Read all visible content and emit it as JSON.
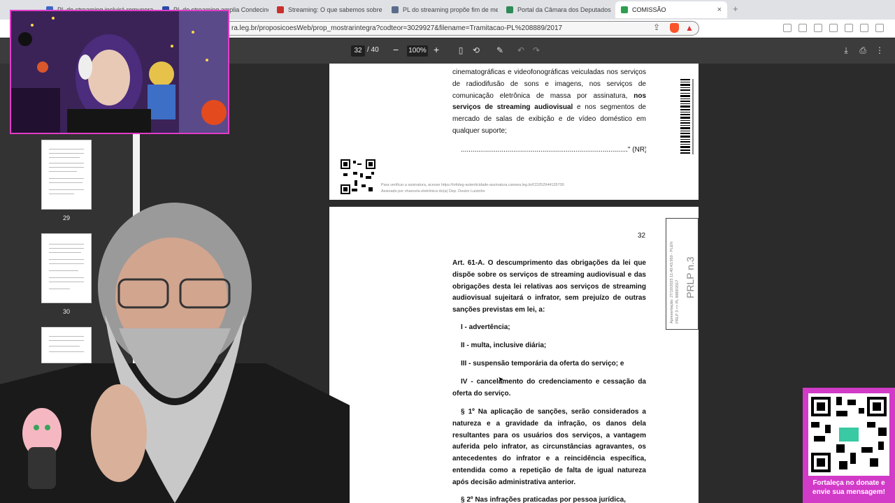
{
  "tabs": [
    {
      "label": "PL do streaming incluirá remunera",
      "color": "#3b67c7"
    },
    {
      "label": "PL do streaming amplia Condecine",
      "color": "#2a4aa8"
    },
    {
      "label": "Streaming: O que sabemos sobre",
      "color": "#c9302c"
    },
    {
      "label": "PL do streaming propõe fim de me",
      "color": "#5b6c8a"
    },
    {
      "label": "Portal da Câmara dos Deputados",
      "color": "#2e8b57"
    },
    {
      "label": "COMISSÃO",
      "color": "#2e9e4f"
    }
  ],
  "tab_close": "×",
  "new_tab": "+",
  "address": {
    "url": "ra.leg.br/proposicoesWeb/prop_mostrarintegra?codteor=3029927&filename=Tramitacao-PL%208889/2017"
  },
  "pdf_toolbar": {
    "page_current": "32",
    "page_total": "/ 40",
    "zoom_minus": "−",
    "zoom": "100%",
    "zoom_plus": "+"
  },
  "thumbnails": [
    {
      "num": "29"
    },
    {
      "num": "30"
    }
  ],
  "page_a": {
    "paragraph_html_parts": [
      "cinematográficas e videofonográficas veiculadas nos serviços de radiodifusão de sons e imagens, nos serviços de comunicação eletrônica de massa por assinatura,",
      "nos serviços de streaming audiovisual",
      "e nos segmentos de mercado de salas de exibição e de vídeo doméstico em qualquer suporte;"
    ],
    "nr_line": "......................................................................................\" (NR)",
    "verify_line1": "Para verificar a assinatura, acesse https://infoleg-autenticidade-assinatura.camara.leg.br/CD252944135700",
    "verify_line2": "Assinado por chancela eletrônica do(a) Dep. Doutor Luizinho"
  },
  "page_b": {
    "page_number": "32",
    "art": "Art. 61-A. O descumprimento das obrigações da lei que dispõe sobre os serviços de streaming audiovisual e das obrigações desta lei relativas aos serviços de streaming audiovisual sujeitará o infrator, sem prejuízo de outras sanções previstas em lei, a:",
    "item1": "I - advertência;",
    "item2": "II - multa, inclusive diária;",
    "item3": "III - suspensão temporária da oferta do serviço; e",
    "item4": "IV - cancelamento do credenciamento e cessação da oferta do serviço.",
    "par1": "§ 1º Na aplicação de sanções, serão considerados a natureza e a gravidade da infração, os danos dela resultantes para os usuários dos serviços, a vantagem auferida pelo infrator, as circunstâncias agravantes, os antecedentes do infrator e a reincidência específica, entendida como a repetição de falta de igual natureza após decisão administrativa anterior.",
    "par2": "§ 2º Nas infrações praticadas por pessoa jurídica,",
    "stamp_small": "Apresentação: 27/10/2025 11:40:43.950 - PLEN",
    "stamp_small2": "PRLP 3 => PL 8889/2017",
    "stamp_big": "PRLP n.3"
  },
  "donate": {
    "line1": "Fortaleça no donate e",
    "line2": "envie sua mensagem!"
  }
}
